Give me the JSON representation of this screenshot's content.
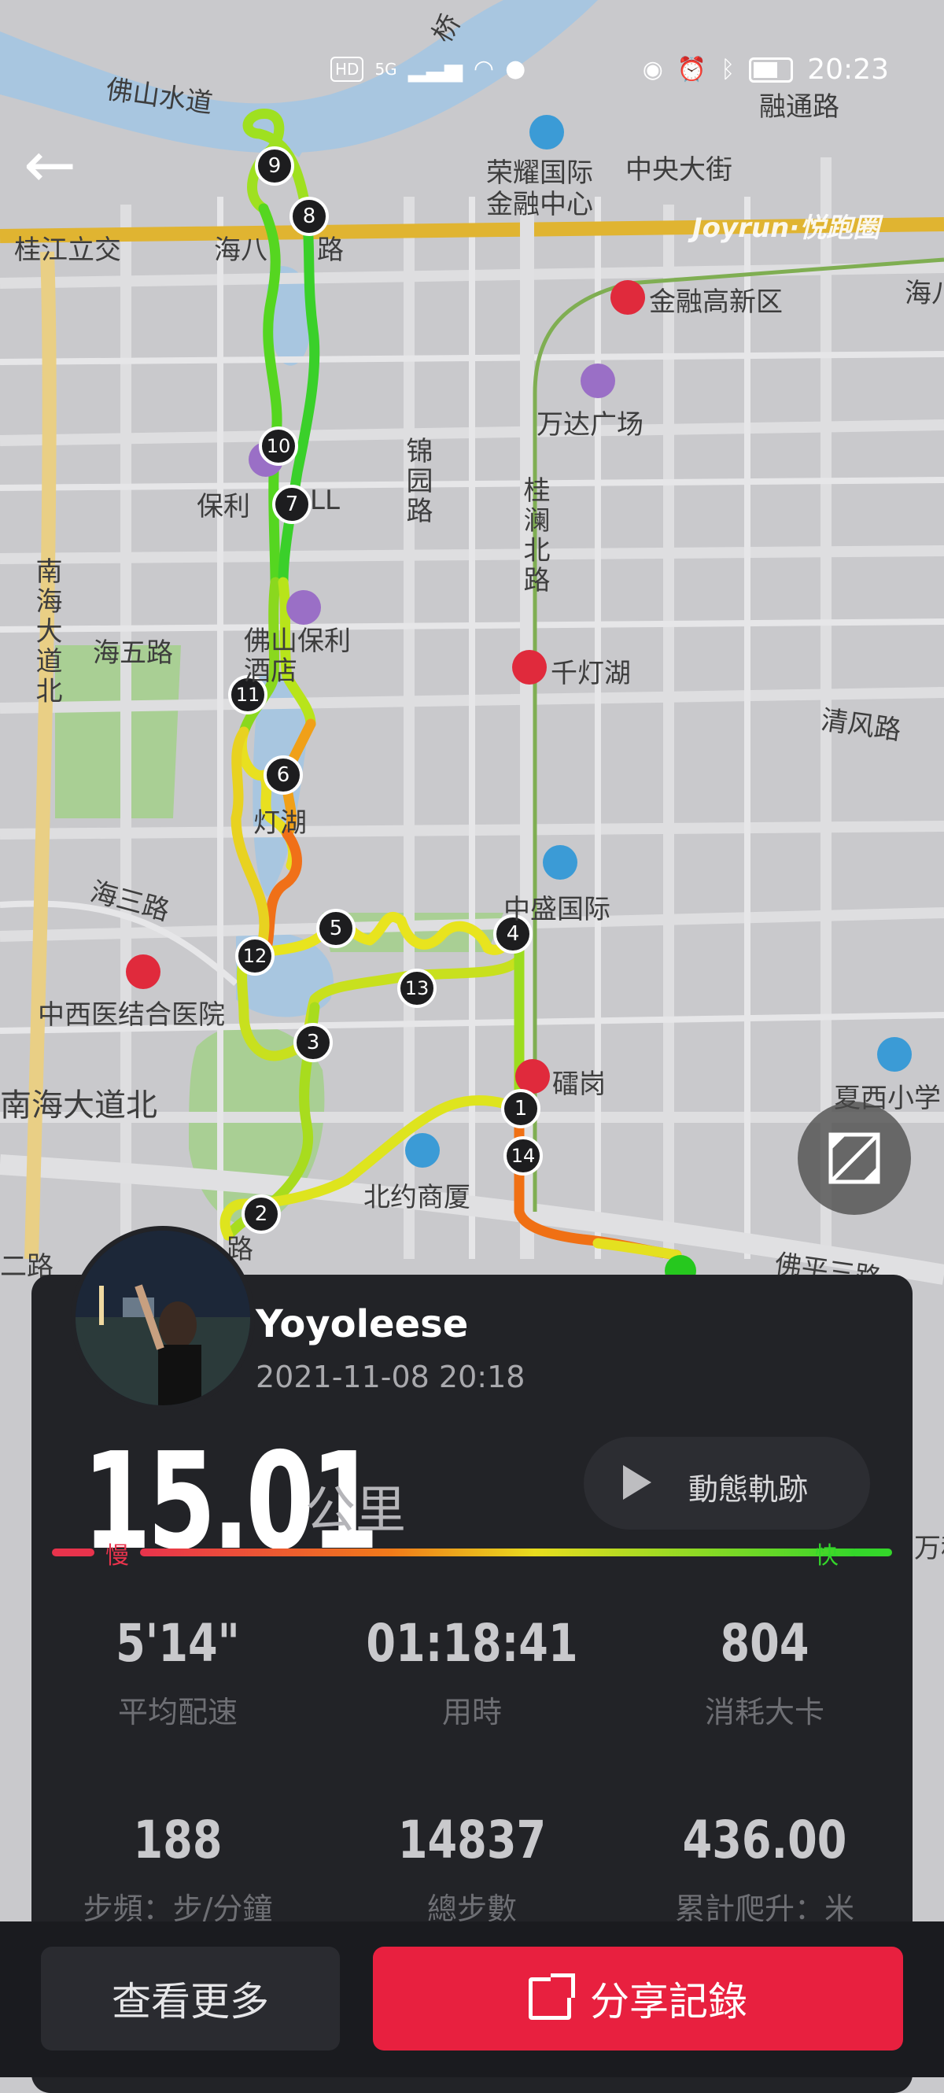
{
  "status_bar": {
    "network_label": "HD",
    "network_type": "5G",
    "time": "20:23",
    "icons": [
      "signal-icon",
      "wifi-icon",
      "wechat-icon",
      "eye-icon",
      "alarm-icon",
      "bluetooth-icon",
      "battery-icon"
    ]
  },
  "map": {
    "watermark": "Joyrun·悦跑圈",
    "labels": {
      "fo_shan_shui_dao": "佛山水道",
      "rong_tong_lu": "融通路",
      "rong_yao": "荣耀国际\n金融中心",
      "zhong_yang": "中央大街",
      "gui_jiang": "桂江立交",
      "hai_ba": "海八",
      "hai_ba_lu": "路",
      "jin_rong": "金融高新区",
      "hai_right": "海八",
      "wan_da": "万达广场",
      "jin_yuan_lu": "锦园路",
      "gui_lan_bei_lu": "桂澜北路",
      "bao_li_mall": "保利",
      "mall": "LL",
      "nan_hai_da_dao_bei": "南海大道北",
      "hai_wu_lu": "海五路",
      "bao_li_hotel": "佛山保利\n酒店",
      "qian_deng_hu": "千灯湖",
      "qing_feng_lu": "清风路",
      "qian_deng_hu_lake": "灯湖",
      "zhong_sheng": "中盛国际",
      "hai_san_lu": "海三路",
      "zhong_xi_yi": "中西医结合医院",
      "lei_gang": "礌岗",
      "xia_xi": "夏西小学",
      "nan_hai_bottom": "南海大道北",
      "bei_yue": "北约商厦",
      "lu_small": "路",
      "er_lu": "二路",
      "fo_ping": "佛平三路",
      "right_edge_1": "万科",
      "qiao": "桥"
    },
    "markers": [
      "1",
      "2",
      "3",
      "4",
      "5",
      "6",
      "7",
      "8",
      "9",
      "10",
      "11",
      "12",
      "13",
      "14"
    ],
    "colors": {
      "fast": "#3ee02a",
      "medium": "#d6ee1a",
      "slow": "#f0581a",
      "water": "#a8c6e0",
      "park": "#a9cf94",
      "road_major": "#e0b431"
    }
  },
  "card": {
    "username": "Yoyoleese",
    "datetime": "2021-11-08 20:18",
    "distance": "15.01",
    "unit": "公里",
    "replay_label": "動態軌跡",
    "pace_slow": "慢",
    "pace_fast": "快",
    "stats": [
      {
        "value": "5'14\"",
        "label": "平均配速"
      },
      {
        "value": "01:18:41",
        "label": "用時"
      },
      {
        "value": "804",
        "label": "消耗大卡"
      },
      {
        "value": "188",
        "label": "步頻：步/分鐘"
      },
      {
        "value": "14837",
        "label": "總步數"
      },
      {
        "value": "436.00",
        "label": "累計爬升：米"
      }
    ]
  },
  "buttons": {
    "more": "查看更多",
    "share": "分享記錄"
  }
}
